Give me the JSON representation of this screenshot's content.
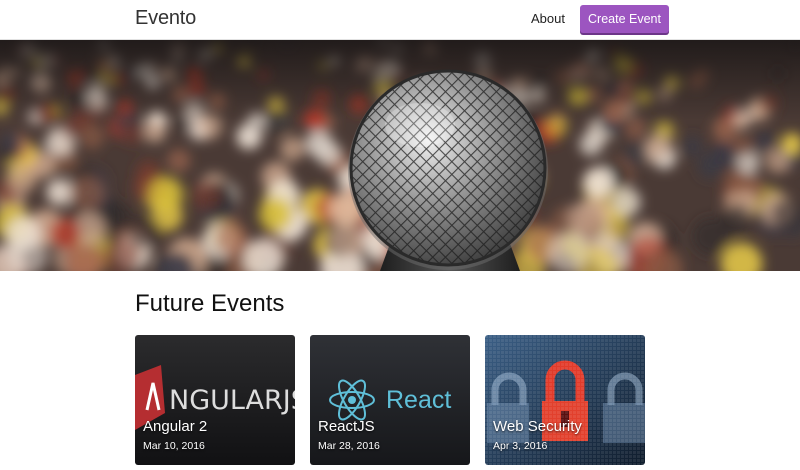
{
  "navbar": {
    "brand": "Evento",
    "about_label": "About",
    "create_label": "Create Event",
    "accent_color": "#9c55c0"
  },
  "hero": {
    "image": "concert-audience-microphone"
  },
  "section": {
    "title": "Future Events"
  },
  "events": [
    {
      "title": "Angular 2",
      "date": "Mar 10, 2016",
      "image": "angular-logo",
      "logo_text": "NGULARJS"
    },
    {
      "title": "ReactJS",
      "date": "Mar 28, 2016",
      "image": "react-logo",
      "logo_text": "React"
    },
    {
      "title": "Web Security",
      "date": "Apr 3, 2016",
      "image": "padlock-pixel-screen"
    }
  ]
}
